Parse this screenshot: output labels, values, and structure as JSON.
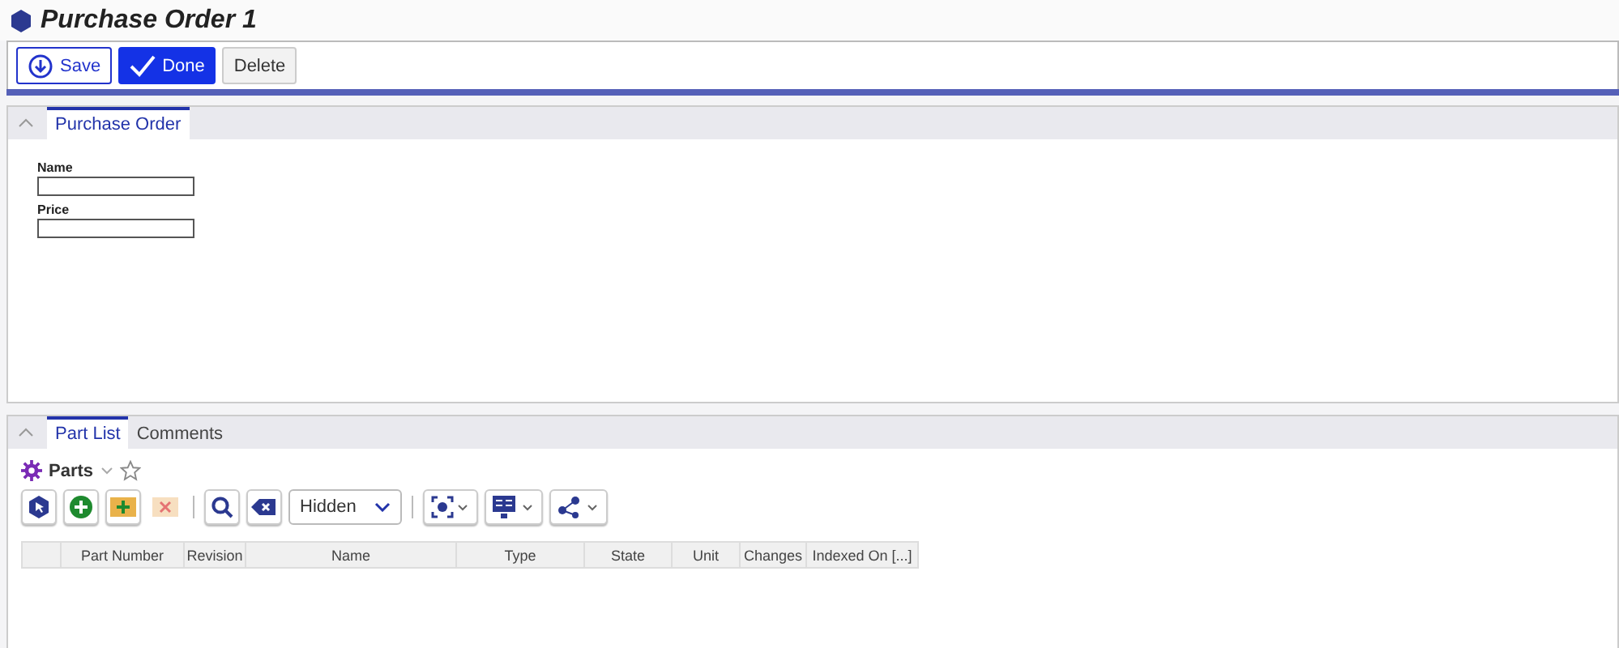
{
  "window": {
    "title": "Purchase Order 1"
  },
  "actions": [
    {
      "label": "Save",
      "kind": "save"
    },
    {
      "label": "Done",
      "kind": "done"
    },
    {
      "label": "Delete",
      "kind": "plain"
    }
  ],
  "form_panel": {
    "tabs": [
      {
        "label": "Purchase Order",
        "selected": true
      }
    ],
    "fields": [
      {
        "label": "Name"
      },
      {
        "label": "Price"
      }
    ]
  },
  "relations_panel": {
    "tabs": [
      {
        "label": "Part List",
        "selected": true
      },
      {
        "label": "Comments",
        "selected": false
      }
    ],
    "grid_title": "Parts",
    "favorite": false,
    "toolbar": [
      {
        "kind": "pick",
        "disabled": false
      },
      {
        "kind": "add",
        "disabled": false
      },
      {
        "kind": "insert",
        "disabled": false
      },
      {
        "kind": "remove",
        "disabled": true
      },
      {
        "kind": "sep"
      },
      {
        "kind": "search",
        "disabled": false
      },
      {
        "kind": "clear",
        "disabled": false
      },
      {
        "kind": "select",
        "value": "Hidden"
      },
      {
        "kind": "sep"
      },
      {
        "kind": "view",
        "disabled": false
      },
      {
        "kind": "layout",
        "disabled": false
      },
      {
        "kind": "share",
        "disabled": false
      }
    ],
    "columns": [
      "Part Number",
      "Revision",
      "Name",
      "Type",
      "State",
      "Unit",
      "Changes",
      "Indexed On [...]"
    ]
  }
}
